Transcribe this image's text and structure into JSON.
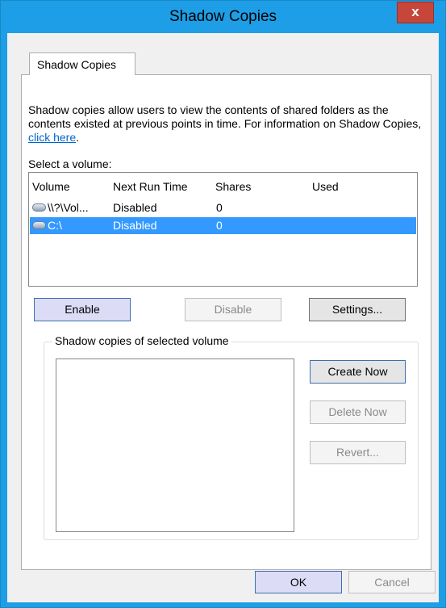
{
  "window": {
    "title": "Shadow Copies",
    "close_label": "x"
  },
  "tab": {
    "label": "Shadow Copies"
  },
  "intro": {
    "text": "Shadow copies allow users to view the contents of shared folders as the contents existed at previous points in time. For information on Shadow Copies, ",
    "link": "click here",
    "end": "."
  },
  "select_label": "Select a volume:",
  "volume_list": {
    "columns": [
      "Volume",
      "Next Run Time",
      "Shares",
      "Used"
    ],
    "rows": [
      {
        "volume": "\\\\?\\Vol...",
        "next_run": "Disabled",
        "shares": "0",
        "used": "",
        "icon": "drive-icon",
        "selected": false
      },
      {
        "volume": "C:\\",
        "next_run": "Disabled",
        "shares": "0",
        "used": "",
        "icon": "drive-icon",
        "selected": true
      }
    ]
  },
  "buttons": {
    "enable": "Enable",
    "disable": "Disable",
    "settings": "Settings...",
    "create_now": "Create Now",
    "delete_now": "Delete Now",
    "revert": "Revert...",
    "ok": "OK",
    "cancel": "Cancel"
  },
  "group": {
    "label": "Shadow copies of selected volume"
  },
  "colors": {
    "titlebar": "#1d9ee6",
    "close": "#c7463a",
    "selection": "#3399ff",
    "link": "#0066cc"
  }
}
